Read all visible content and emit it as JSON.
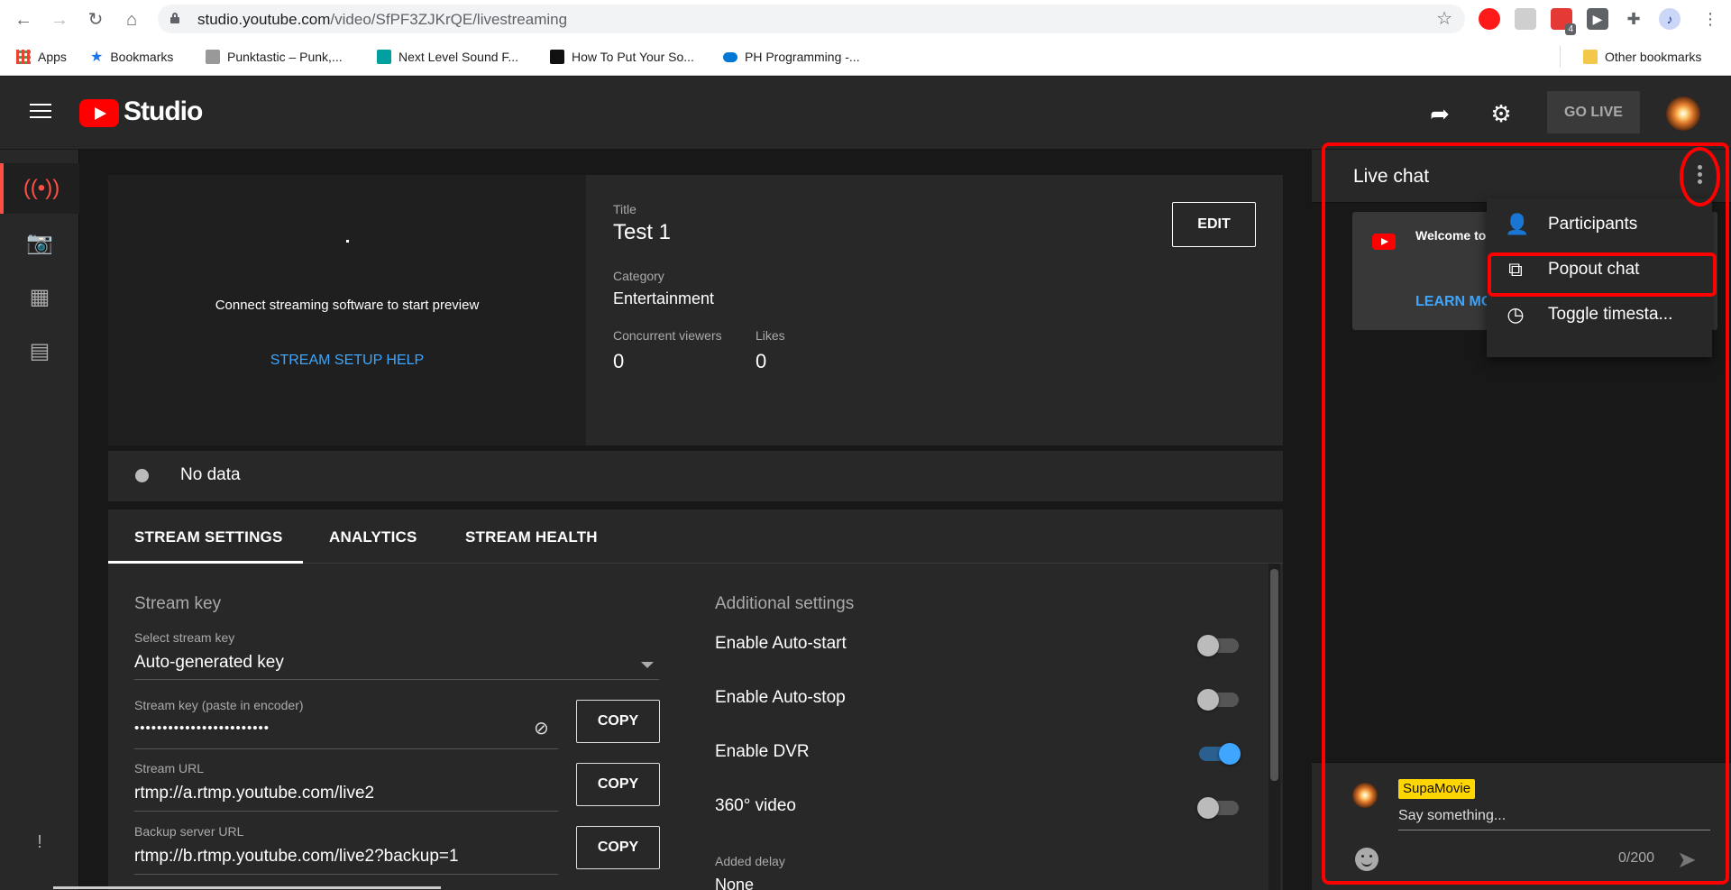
{
  "browser": {
    "url_host": "studio.youtube.com",
    "url_path": "/video/SfPF3ZJKrQE/livestreaming",
    "bookmarks": [
      {
        "label": "Apps",
        "icon": "apps-grid-icon",
        "color": "#4285f4"
      },
      {
        "label": "Bookmarks",
        "icon": "star-icon",
        "color": "#1a73e8"
      },
      {
        "label": "Punktastic – Punk,...",
        "icon": "punktastic-icon",
        "color": "#777777"
      },
      {
        "label": "Next Level Sound F...",
        "icon": "next-level-sound-icon",
        "color": "#00a0a0"
      },
      {
        "label": "How To Put Your So...",
        "icon": "play-icon",
        "color": "#111111"
      },
      {
        "label": "PH Programming -...",
        "icon": "cloud-icon",
        "color": "#0078d4"
      }
    ],
    "other_bookmarks": "Other bookmarks",
    "extension_badge": "4"
  },
  "studio": {
    "logo_text": "Studio",
    "go_live_label": "GO LIVE"
  },
  "preview": {
    "message": "Connect streaming software to start preview",
    "help_link": "STREAM SETUP HELP"
  },
  "info": {
    "title_label": "Title",
    "title_value": "Test 1",
    "category_label": "Category",
    "category_value": "Entertainment",
    "viewers_label": "Concurrent viewers",
    "viewers_value": "0",
    "likes_label": "Likes",
    "likes_value": "0",
    "edit_label": "EDIT"
  },
  "status": {
    "text": "No data"
  },
  "tabs": [
    "STREAM SETTINGS",
    "ANALYTICS",
    "STREAM HEALTH"
  ],
  "stream": {
    "section_title": "Stream key",
    "select_label": "Select stream key",
    "select_value": "Auto-generated key",
    "key_label": "Stream key (paste in encoder)",
    "key_value": "••••••••••••••••••••••••",
    "url_label": "Stream URL",
    "url_value": "rtmp://a.rtmp.youtube.com/live2",
    "backup_label": "Backup server URL",
    "backup_value": "rtmp://b.rtmp.youtube.com/live2?backup=1",
    "copy_label": "COPY"
  },
  "additional": {
    "section_title": "Additional settings",
    "options": [
      {
        "label": "Enable Auto-start",
        "on": false
      },
      {
        "label": "Enable Auto-stop",
        "on": false
      },
      {
        "label": "Enable DVR",
        "on": true
      },
      {
        "label": "360° video",
        "on": false
      }
    ],
    "delay_label": "Added delay",
    "delay_value": "None"
  },
  "chat": {
    "title": "Live chat",
    "welcome_text": "Welcome to your privacy guidelines.",
    "learn_more": "LEARN MO",
    "menu": [
      {
        "label": "Participants",
        "icon": "person-icon"
      },
      {
        "label": "Popout chat",
        "icon": "popout-icon"
      },
      {
        "label": "Toggle timesta...",
        "icon": "clock-icon"
      }
    ],
    "username": "SupaMovie",
    "placeholder": "Say something...",
    "counter": "0/200"
  },
  "colors": {
    "accent_red": "#ff0000",
    "link_blue": "#3ea6ff",
    "badge_yellow": "#ffd600",
    "annotation_red": "#ff0000"
  }
}
